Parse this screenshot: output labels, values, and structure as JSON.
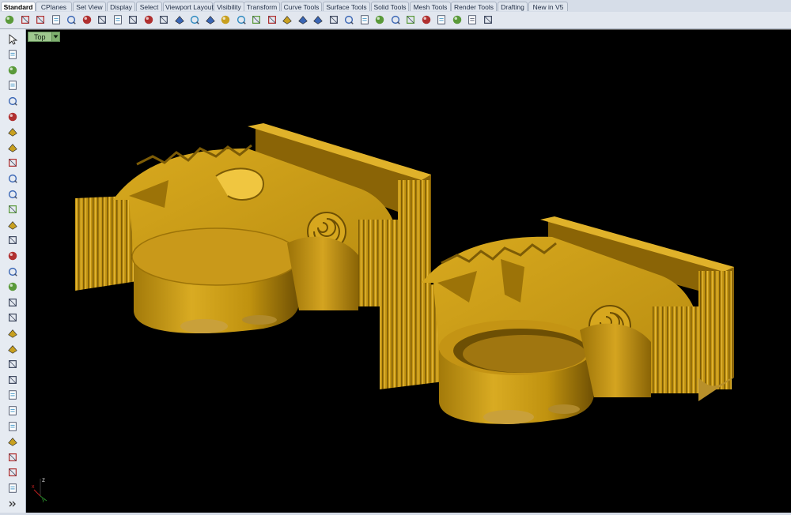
{
  "tabs": [
    {
      "label": "Standard",
      "active": true
    },
    {
      "label": "CPlanes"
    },
    {
      "label": "Set View"
    },
    {
      "label": "Display"
    },
    {
      "label": "Select"
    },
    {
      "label": "Viewport Layout"
    },
    {
      "label": "Visibility"
    },
    {
      "label": "Transform"
    },
    {
      "label": "Curve Tools"
    },
    {
      "label": "Surface Tools"
    },
    {
      "label": "Solid Tools"
    },
    {
      "label": "Mesh Tools"
    },
    {
      "label": "Render Tools"
    },
    {
      "label": "Drafting"
    },
    {
      "label": "New in V5"
    }
  ],
  "toolbar_icons": [
    "new-file",
    "open-file",
    "save-file",
    "print",
    "import",
    "cut",
    "copy",
    "paste",
    "undo",
    "pan",
    "move",
    "zoom-dynamic",
    "zoom-window",
    "zoom-extents",
    "zoom-selected",
    "rotate-view",
    "four-viewports",
    "grid-snap",
    "options",
    "hide-objects",
    "show-objects",
    "lock",
    "unlock",
    "layer",
    "material",
    "render",
    "render-preview",
    "sun",
    "shade",
    "rendered",
    "properties",
    "help"
  ],
  "sidebar_icons": [
    "select-pointer",
    "point",
    "polyline",
    "curve",
    "circle",
    "arc",
    "ellipse",
    "polygon",
    "rectangle",
    "fillet",
    "offset",
    "freeform-curve",
    "extrude",
    "loft",
    "box",
    "sphere",
    "cylinder",
    "cone",
    "mesh",
    "boolean",
    "explode",
    "join",
    "trim",
    "split",
    "group",
    "array",
    "analyze",
    "dimension",
    "transform",
    "solid",
    "more"
  ],
  "viewport": {
    "name": "Top",
    "background": "#000000",
    "axis": {
      "z": "z",
      "x": "x",
      "y": "y"
    }
  },
  "colors": {
    "model": "#c89a14",
    "model_dark": "#7a5a06",
    "model_light": "#e6bd3a"
  }
}
